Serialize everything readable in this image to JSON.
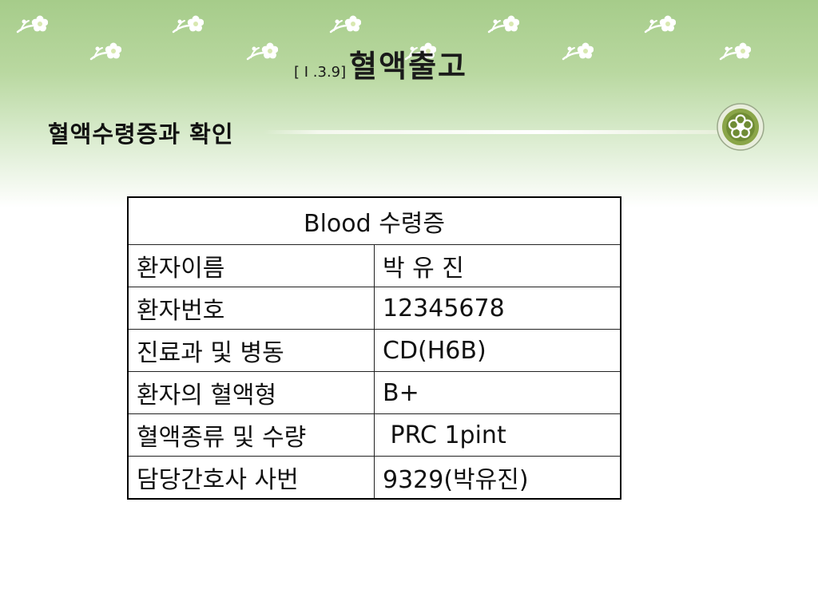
{
  "slide": {
    "section_code": "[ I .3.9]",
    "title": "혈액출고",
    "subtitle": "혈액수령증과 확인"
  },
  "table": {
    "header": "Blood 수령증",
    "rows": [
      {
        "label": "환자이름",
        "value": "박 유 진"
      },
      {
        "label": "환자번호",
        "value": "12345678"
      },
      {
        "label": "진료과 및 병동",
        "value": "CD(H6B)"
      },
      {
        "label": "환자의 혈액형",
        "value": "B+"
      },
      {
        "label": "혈액종류 및 수량",
        "value": " PRC 1pint"
      },
      {
        "label": "담당간호사 사번",
        "value": "9329(박유진)"
      }
    ]
  },
  "decor": {
    "icons": [
      "flower-icon",
      "ornament-icon"
    ],
    "colors": {
      "header_green": "#a6cc8a",
      "ink": "#111111",
      "ornament": "#7c9a3c"
    }
  }
}
